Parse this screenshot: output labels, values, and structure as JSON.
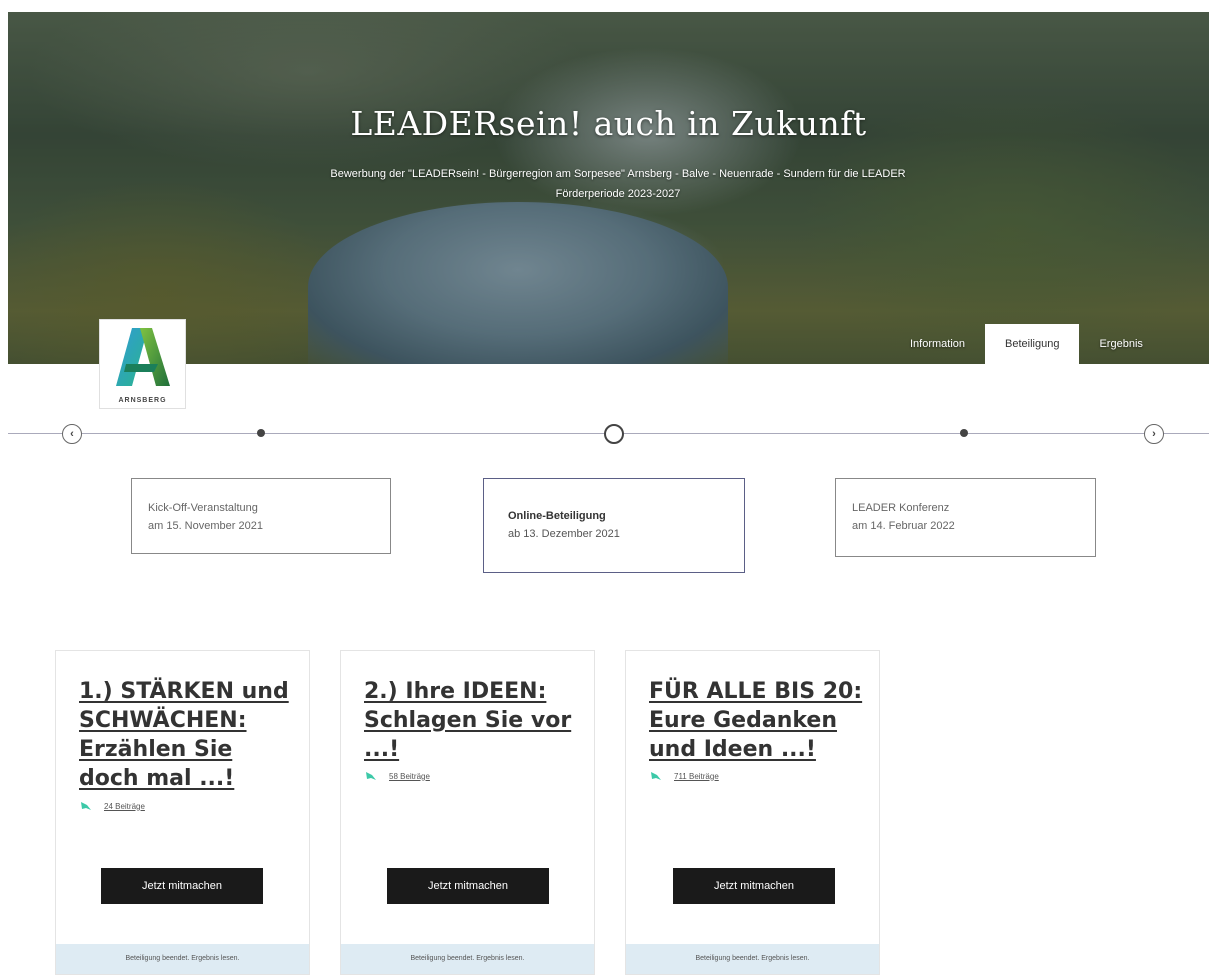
{
  "hero": {
    "title": "LEADERsein! auch in Zukunft",
    "subtitle": "Bewerbung der \"LEADERsein! - Bürgerregion am Sorpesee\" Arnsberg - Balve - Neuenrade - Sundern für die LEADER Förderperiode 2023-2027"
  },
  "tabs": [
    {
      "label": "Information"
    },
    {
      "label": "Beteiligung"
    },
    {
      "label": "Ergebnis"
    }
  ],
  "logo": {
    "text": "ARNSBERG"
  },
  "timeline": {
    "prev_icon": "‹",
    "next_icon": "›",
    "events": [
      {
        "title": "Kick-Off-Veranstaltung",
        "date": "am 15. November 2021"
      },
      {
        "title": "Online-Beteiligung",
        "date": "ab 13. Dezember 2021"
      },
      {
        "title": "LEADER Konferenz",
        "date": "am 14. Februar 2022"
      }
    ]
  },
  "cards": [
    {
      "title": "1.) STÄRKEN und SCHWÄCHEN: Erzählen Sie doch mal ...!",
      "contributions": "24 Beiträge",
      "cta": "Jetzt mitmachen",
      "footer": "Beteiligung beendet. Ergebnis lesen."
    },
    {
      "title": "2.) Ihre IDEEN: Schlagen Sie vor ...!",
      "contributions": "58 Beiträge",
      "cta": "Jetzt mitmachen",
      "footer": "Beteiligung beendet. Ergebnis lesen."
    },
    {
      "title": "FÜR ALLE BIS 20: Eure Gedanken und Ideen ...!",
      "contributions": "711 Beiträge",
      "cta": "Jetzt mitmachen",
      "footer": "Beteiligung beendet. Ergebnis lesen."
    }
  ],
  "colors": {
    "accent": "#3cc9a8",
    "button": "#1a1a1a",
    "card_footer": "#deebf3"
  }
}
